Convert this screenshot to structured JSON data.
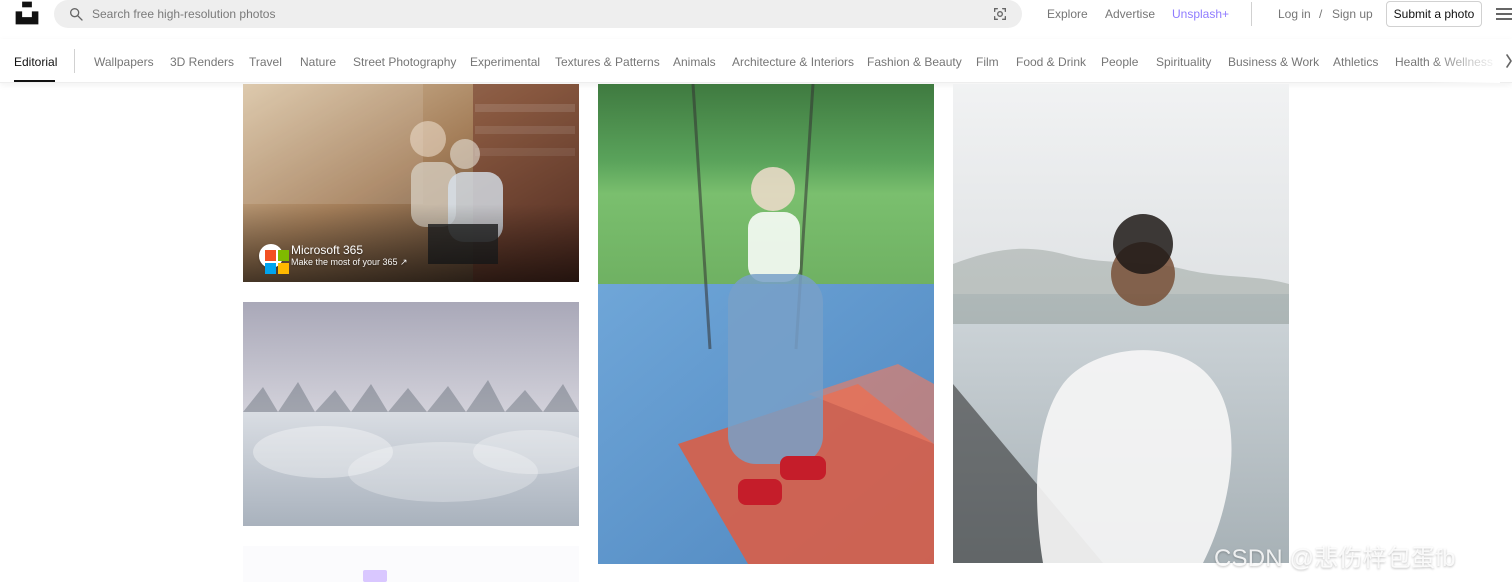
{
  "header": {
    "search_placeholder": "Search free high-resolution photos",
    "links": {
      "explore": "Explore",
      "advertise": "Advertise",
      "unsplash_plus": "Unsplash+",
      "login": "Log in",
      "slash": "/",
      "signup": "Sign up"
    },
    "submit_label": "Submit a photo",
    "icons": {
      "logo": "unsplash-logo",
      "search": "search-icon",
      "visual_search": "visual-search-icon",
      "menu": "menu-icon"
    },
    "colors": {
      "unsplash_plus": "#8f7cff"
    }
  },
  "categories": {
    "items": [
      {
        "label": "Editorial",
        "active": true
      },
      {
        "label": "Wallpapers"
      },
      {
        "label": "3D Renders"
      },
      {
        "label": "Travel"
      },
      {
        "label": "Nature"
      },
      {
        "label": "Street Photography"
      },
      {
        "label": "Experimental"
      },
      {
        "label": "Textures & Patterns"
      },
      {
        "label": "Animals"
      },
      {
        "label": "Architecture & Interiors"
      },
      {
        "label": "Fashion & Beauty"
      },
      {
        "label": "Film"
      },
      {
        "label": "Food & Drink"
      },
      {
        "label": "People"
      },
      {
        "label": "Spirituality"
      },
      {
        "label": "Business & Work"
      },
      {
        "label": "Athletics"
      },
      {
        "label": "Health & Wellness"
      }
    ],
    "icons": {
      "next": "chevron-right-icon"
    }
  },
  "grid": {
    "photos": [
      {
        "sponsor": {
          "name": "Microsoft 365",
          "tagline": "Make the most of your 365 ↗",
          "icon": "microsoft-logo-icon"
        }
      },
      {},
      {},
      {},
      {}
    ]
  },
  "watermark": "CSDN @悲伤梓包蛋fb"
}
